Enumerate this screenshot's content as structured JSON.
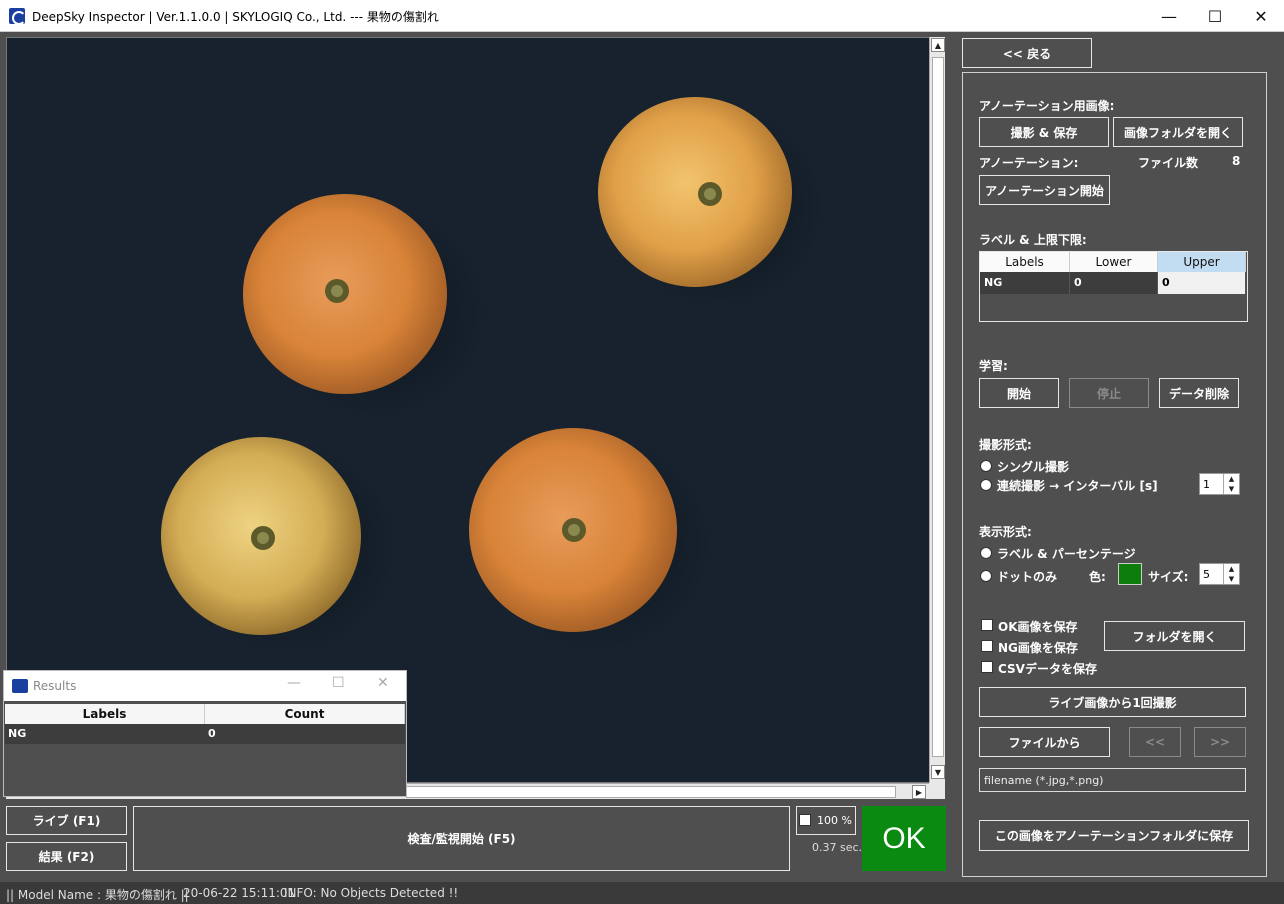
{
  "window": {
    "title": "DeepSky Inspector | Ver.1.1.0.0 | SKYLOGIQ Co., Ltd. --- 果物の傷割れ",
    "minimize": "—",
    "maximize": "☐",
    "close": "✕"
  },
  "results_window": {
    "title": "Results",
    "columns": [
      "Labels",
      "Count"
    ],
    "rows": [
      [
        "NG",
        "0"
      ]
    ]
  },
  "bottom": {
    "live_button": "ライブ (F1)",
    "results_button": "結果 (F2)",
    "inspect_button": "検査/監視開始 (F5)",
    "percent_label": "100 %",
    "time_label": "0.37 sec.",
    "verdict": "OK"
  },
  "status": {
    "model": "|| Model Name : 果物の傷割れ ||",
    "timestamp": "20-06-22 15:11:01",
    "info": "INFO:   No Objects Detected !!"
  },
  "panel": {
    "back_button": "<< 戻る",
    "annotation_image_heading": "アノーテーション用画像:",
    "capture_save_button": "撮影 & 保存",
    "open_image_folder_button": "画像フォルダを開く",
    "annotation_heading": "アノーテーション:",
    "file_count_label": "ファイル数",
    "file_count_value": "8",
    "start_annotation_button": "アノーテーション開始",
    "label_limits_heading": "ラベル & 上限下限:",
    "label_table": {
      "columns": [
        "Labels",
        "Lower",
        "Upper"
      ],
      "rows": [
        [
          "NG",
          "0",
          "0"
        ]
      ]
    },
    "learning_heading": "学習:",
    "learn_start_button": "開始",
    "learn_stop_button": "停止",
    "delete_data_button": "データ削除",
    "capture_mode_heading": "撮影形式:",
    "single_capture_label": "シングル撮影",
    "continuous_capture_label": "連続撮影 → インターバル [s]",
    "interval_value": "1",
    "display_mode_heading": "表示形式:",
    "label_percent_option": "ラベル & パーセンテージ",
    "dot_only_option": "ドットのみ",
    "color_label": "色:",
    "dot_color": "#0a7d0a",
    "size_label": "サイズ:",
    "size_value": "5",
    "save_ok_label": "OK画像を保存",
    "save_ng_label": "NG画像を保存",
    "save_csv_label": "CSVデータを保存",
    "open_folder_button": "フォルダを開く",
    "capture_once_button": "ライブ画像から1回撮影",
    "from_file_button": "ファイルから",
    "prev_button": "<<",
    "next_button": ">>",
    "filename_placeholder": "filename (*.jpg,*.png)",
    "save_to_annotation_button": "この画像をアノーテーションフォルダに保存"
  }
}
